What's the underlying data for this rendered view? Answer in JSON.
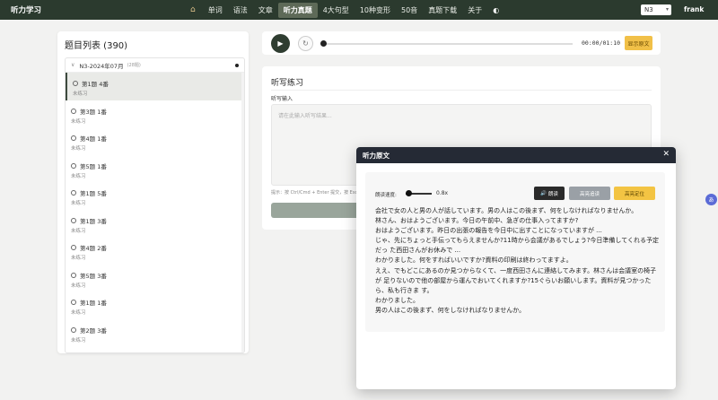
{
  "app": {
    "title": "听力学习"
  },
  "nav": {
    "home_icon": "home-icon",
    "items": [
      "单词",
      "语法",
      "文章",
      "听力真题",
      "4大句型",
      "10种变形",
      "50音",
      "真题下载",
      "关于"
    ],
    "active_index": 3,
    "extra_icon": "palette-icon"
  },
  "header": {
    "level_select": "N3",
    "user": "frank"
  },
  "sidebar": {
    "title": "题目列表 (390)",
    "group": {
      "name": "N3-2024年07月",
      "count": "(28题)"
    },
    "questions": [
      {
        "title": "第1题 4番",
        "status": "未练习"
      },
      {
        "title": "第3题 1番",
        "status": "未练习"
      },
      {
        "title": "第4题 1番",
        "status": "未练习"
      },
      {
        "title": "第5题 1番",
        "status": "未练习"
      },
      {
        "title": "第1题 5番",
        "status": "未练习"
      },
      {
        "title": "第1题 3番",
        "status": "未练习"
      },
      {
        "title": "第4题 2番",
        "status": "未练习"
      },
      {
        "title": "第5题 3番",
        "status": "未练习"
      },
      {
        "title": "第1题 1番",
        "status": "未练习"
      },
      {
        "title": "第2题 3番",
        "status": "未练习"
      }
    ]
  },
  "player": {
    "time": "00:00/01:10",
    "progress": 0,
    "show_text_label": "显示原文"
  },
  "dictation": {
    "title": "听写练习",
    "input_label": "听写输入",
    "placeholder": "请在此输入听写结果...",
    "hint": "提示：按 Ctrl/Cmd + Enter 提交，按 Esc"
  },
  "modal": {
    "title": "听力原文",
    "speed_label": "朗读速度:",
    "speed_value": "0.8x",
    "read_label": "朗读",
    "highlight_sync_label": "高亮追读",
    "highlight_locate_label": "高亮定位",
    "transcript": [
      "会社で女の人と男の人が話しています。男の人はこの後まず、何をしなければなりませんか。",
      "林さん、おはようございます。今日の午前中、急ぎの仕事入ってますか?",
      "おはようございます。昨日の出張の報告を今日中に出すことになっていますが ...",
      "じゃ、先にちょっと手伝ってもらえませんか?11時から会議があるでしょう?今日準備してくれる予定だっ た西田さんがお休みで ...",
      "わかりました。何をすればいいですか?資料の印刷は終わってますよ。",
      "ええ、でもどこにあるのか見つからなくて、一度西田さんに連絡してみます。林さんは会議室の椅子が 足りないので他の部屋から運んでおいてくれますか?15ぐらいお願いします。資料が見つかったら、私も行きま す。",
      "わかりました。",
      "男の人はこの後まず、何をしなければなりませんか。"
    ]
  },
  "colors": {
    "nav_bg": "#2b3a2e",
    "accent_yellow": "#f1c048",
    "modal_head": "#252a35"
  }
}
